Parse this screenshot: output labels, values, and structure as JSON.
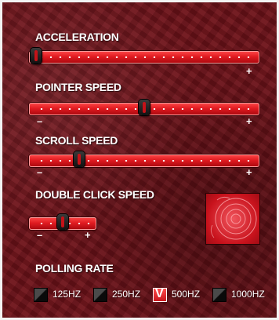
{
  "settings": {
    "acceleration": {
      "label": "ACCELERATION",
      "value": 0.0,
      "max_label": "+"
    },
    "pointer_speed": {
      "label": "POINTER SPEED",
      "value": 0.5,
      "min_label": "–",
      "max_label": "+"
    },
    "scroll_speed": {
      "label": "SCROLL SPEED",
      "value": 0.2,
      "min_label": "–",
      "max_label": "+"
    },
    "double_click_speed": {
      "label": "DOUBLE CLICK SPEED",
      "value": 0.5,
      "min_label": "–",
      "max_label": "+"
    }
  },
  "polling_rate": {
    "label": "POLLING RATE",
    "options": [
      {
        "label": "125HZ",
        "checked": false
      },
      {
        "label": "250HZ",
        "checked": false
      },
      {
        "label": "500HZ",
        "checked": true
      },
      {
        "label": "1000HZ",
        "checked": false
      }
    ],
    "check_mark": "V"
  },
  "colors": {
    "background": "#6e1219",
    "accent": "#e11b21",
    "text": "#ffffff"
  },
  "icons": {
    "preview": "double-click-test-target-icon",
    "thumb": "slider-thumb-icon"
  }
}
